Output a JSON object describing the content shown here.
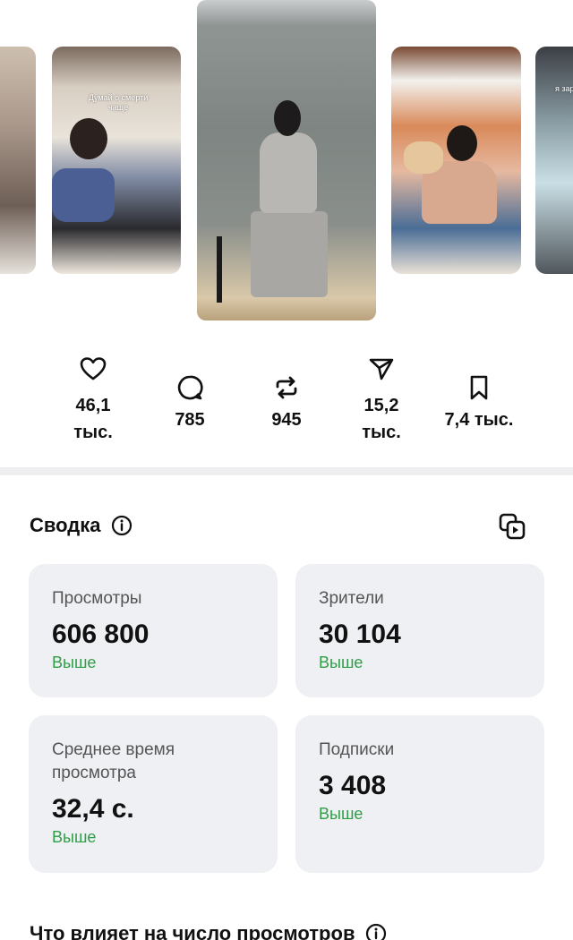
{
  "carousel": {
    "thumbs": [
      {
        "caption": ""
      },
      {
        "caption": "Думай о смерти\nчаще"
      },
      {
        "caption": ""
      },
      {
        "caption": ""
      },
      {
        "caption": "я зар"
      }
    ]
  },
  "stats": {
    "likes": "46,1\nтыс.",
    "comments": "785",
    "reposts": "945",
    "shares": "15,2\nтыс.",
    "saves": "7,4 тыс."
  },
  "summary": {
    "title": "Сводка",
    "cards": [
      {
        "label": "Просмотры",
        "value": "606 800",
        "trend": "Выше"
      },
      {
        "label": "Зрители",
        "value": "30 104",
        "trend": "Выше"
      },
      {
        "label": "Среднее время\nпросмотра",
        "value": "32,4 с.",
        "trend": "Выше"
      },
      {
        "label": "Подписки",
        "value": "3 408",
        "trend": "Выше"
      }
    ]
  },
  "views_factors": {
    "title": "Что влияет на число просмотров"
  },
  "colors": {
    "trend_up": "#2e9e47",
    "card_bg": "#eff0f3",
    "divider": "#eeeef0"
  },
  "icons": [
    "heart-icon",
    "comment-icon",
    "repost-icon",
    "send-icon",
    "bookmark-icon",
    "info-icon",
    "copy-icon"
  ]
}
